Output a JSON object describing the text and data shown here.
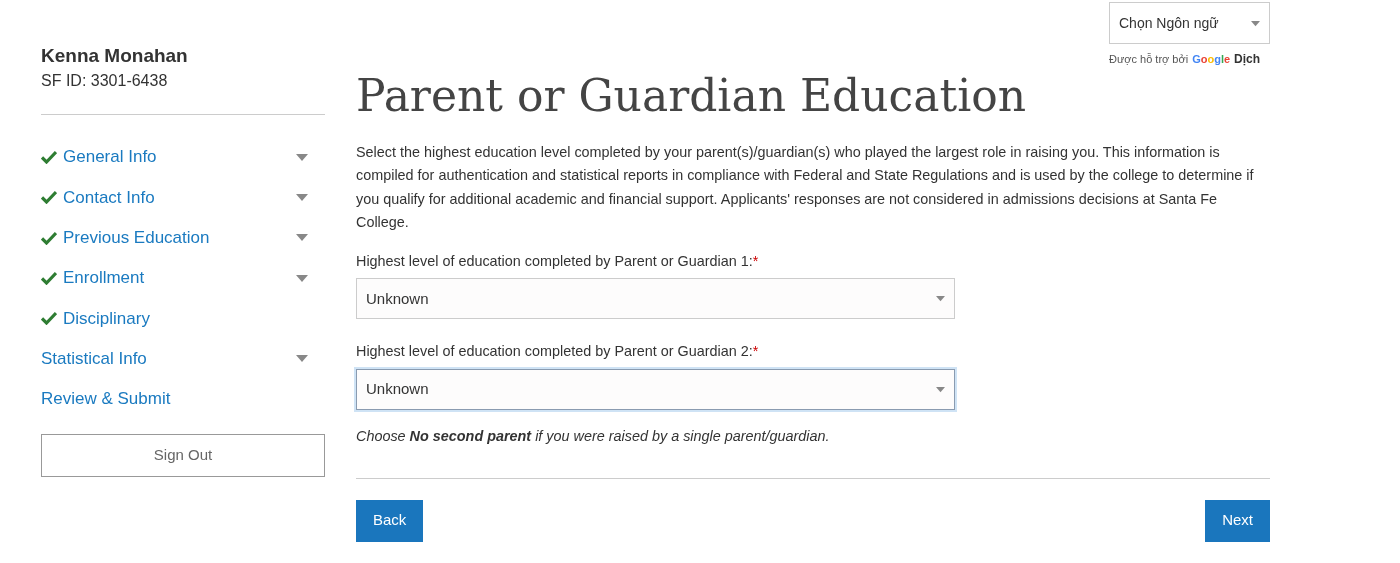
{
  "student": {
    "name": "Kenna Monahan",
    "id": "SF ID: 3301-6438"
  },
  "nav": [
    {
      "label": "General Info",
      "completed": true,
      "expandable": true
    },
    {
      "label": "Contact Info",
      "completed": true,
      "expandable": true
    },
    {
      "label": "Previous Education",
      "completed": true,
      "expandable": true
    },
    {
      "label": "Enrollment",
      "completed": true,
      "expandable": true
    },
    {
      "label": "Disciplinary",
      "completed": true,
      "expandable": false
    },
    {
      "label": "Statistical Info",
      "completed": false,
      "expandable": true
    },
    {
      "label": "Review & Submit",
      "completed": false,
      "expandable": false
    }
  ],
  "sign_out": "Sign Out",
  "translate": {
    "select": "Chọn Ngôn ngữ",
    "powered_by": "Được hỗ trợ bởi",
    "brand": "Google",
    "service": "Dịch"
  },
  "title": "Parent or Guardian Education",
  "intro": "Select the highest education level completed by your parent(s)/guardian(s) who played the largest role in raising you. This information is compiled for authentication and statistical reports in compliance with Federal and State Regulations and is used by the college to determine if you qualify for additional academic and financial support. Applicants' responses are not considered in admissions decisions at Santa Fe College.",
  "fields": [
    {
      "label": "Highest level of education completed by Parent or Guardian 1:",
      "required_mark": "*",
      "value": "Unknown",
      "focused": false
    },
    {
      "label": "Highest level of education completed by Parent or Guardian 2:",
      "required_mark": "*",
      "value": "Unknown",
      "focused": true
    }
  ],
  "note": "Choose **No second parent** if you were raised by a single parent/guardian.",
  "buttons": {
    "back": "Back",
    "next": "Next"
  }
}
